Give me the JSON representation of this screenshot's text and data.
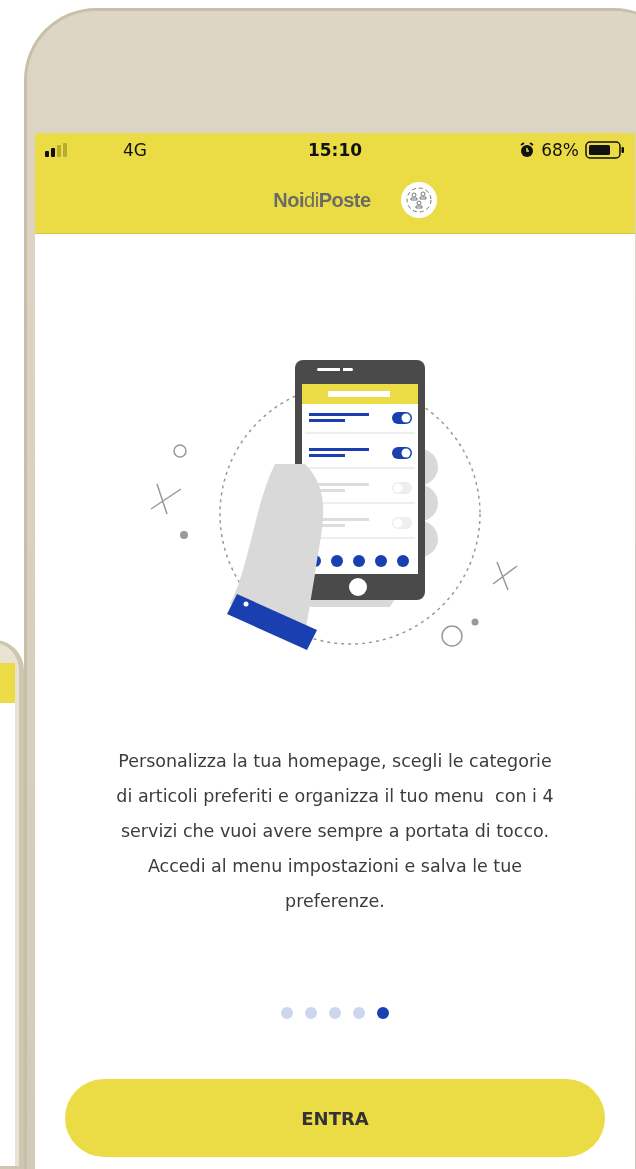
{
  "status_bar": {
    "carrier": "4G",
    "time": "15:10",
    "battery": "68%"
  },
  "header": {
    "logo": "**Noi**di**Poste**"
  },
  "onboarding": {
    "text": "Personalizza la tua homepage, scegli le categorie di articoli preferiti e organizza il tuo menu  con i 4 servizi che vuoi avere sempre a portata di tocco. Accedi al menu impostazioni e salva le tue preferenze.",
    "pages": [
      {
        "selected": false
      },
      {
        "selected": false
      },
      {
        "selected": false
      },
      {
        "selected": false
      },
      {
        "selected": true
      }
    ]
  },
  "button": {
    "label": "ENTRA"
  }
}
